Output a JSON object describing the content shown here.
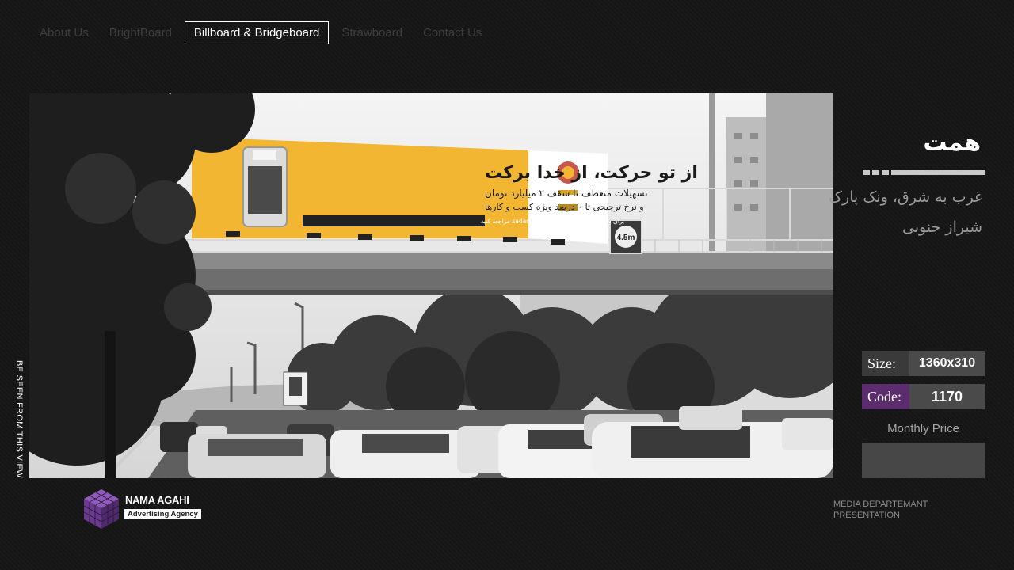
{
  "nav": {
    "items": [
      {
        "label": "About Us",
        "active": false
      },
      {
        "label": "BrightBoard",
        "active": false
      },
      {
        "label": "Billboard & Bridgeboard",
        "active": true
      },
      {
        "label": "Strawboard",
        "active": false
      },
      {
        "label": "Contact Us",
        "active": false
      }
    ]
  },
  "side_label": "BE SEEN FROM THIS VIEW",
  "billboard": {
    "headline": "از تو حرکت، از خدا برکت",
    "line1": "تسهیلات منعطف تا سقف ۲ میلیارد تومان",
    "line2": "و نرخ ترجیحی تا ۰ درصد ویژه کسب و کارها",
    "cta": "برای دریافت اطلاعات بیشتر به sadadpsp.ir مراجعه کنید",
    "speed_sign": "4.5m",
    "accent": "#f2b632"
  },
  "location": {
    "title": "همت",
    "description": "غرب به شرق، ونک پارک شیراز جنوبی"
  },
  "specs": {
    "size_label": "Size:",
    "size_value": "1360x310",
    "code_label": "Code:",
    "code_value": "1170",
    "price_label": "Monthly Price",
    "price_value": "",
    "code_color": "#5b2d6e"
  },
  "brand": {
    "name": "NAMA AGAHI",
    "tagline": "Advertising Agency",
    "color": "#6a3a8f"
  },
  "footer": {
    "line1": "MEDIA DEPARTEMANT",
    "line2": "PRESENTATION"
  }
}
